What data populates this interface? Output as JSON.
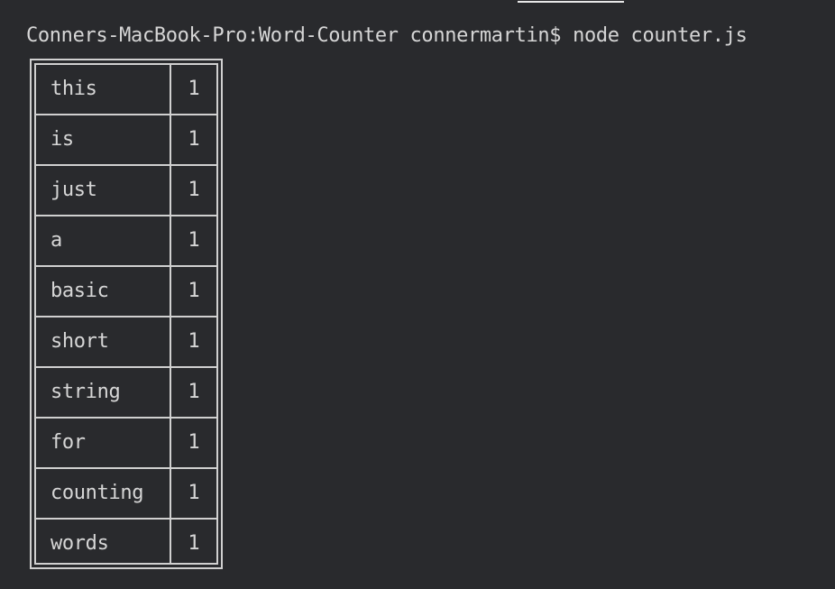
{
  "terminal": {
    "prompt_line": "Conners-MacBook-Pro:Word-Counter connermartin$ node counter.js"
  },
  "table": {
    "rows": [
      {
        "word": "this",
        "count": "1"
      },
      {
        "word": "is",
        "count": "1"
      },
      {
        "word": "just",
        "count": "1"
      },
      {
        "word": "a",
        "count": "1"
      },
      {
        "word": "basic",
        "count": "1"
      },
      {
        "word": "short",
        "count": "1"
      },
      {
        "word": "string",
        "count": "1"
      },
      {
        "word": "for",
        "count": "1"
      },
      {
        "word": "counting",
        "count": "1"
      },
      {
        "word": "words",
        "count": "1"
      }
    ]
  },
  "colors": {
    "background": "#292a2d",
    "text": "#d6d6d6"
  }
}
